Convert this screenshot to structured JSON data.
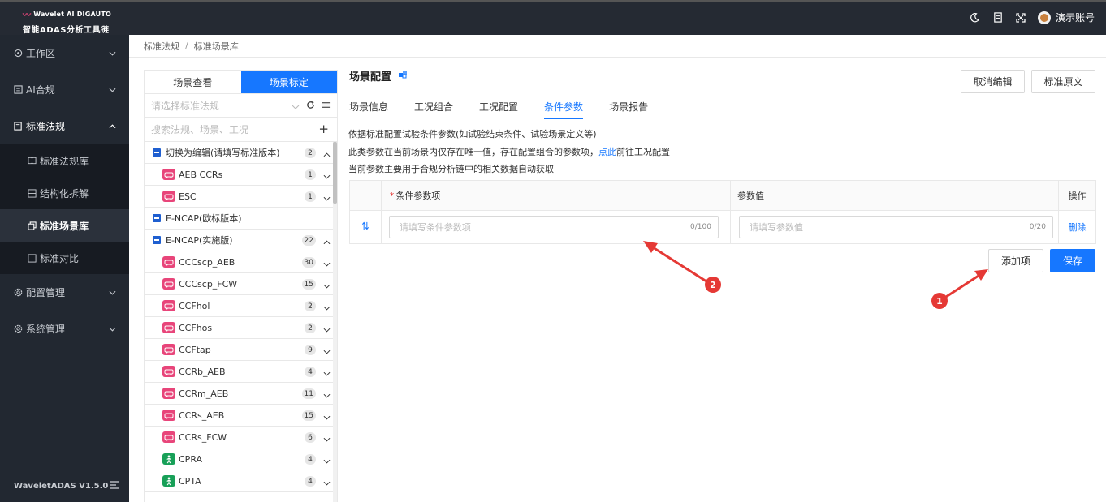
{
  "app": {
    "brand_line": "Wavelet AI  DIGAUTO",
    "subtitle": "智能ADAS分析工具链",
    "user_name": "演示账号",
    "version": "WaveletADAS  V1.5.0"
  },
  "sidebar": {
    "items": [
      {
        "label": "工作区",
        "icon": "workspace-icon"
      },
      {
        "label": "AI合规",
        "icon": "ai-compliance-icon"
      },
      {
        "label": "标准法规",
        "icon": "regulation-icon"
      },
      {
        "label": "配置管理",
        "icon": "gear-icon"
      },
      {
        "label": "系统管理",
        "icon": "gear-icon"
      }
    ],
    "sub_items": [
      {
        "label": "标准法规库"
      },
      {
        "label": "结构化拆解"
      },
      {
        "label": "标准场景库"
      },
      {
        "label": "标准对比"
      }
    ]
  },
  "breadcrumb": {
    "first": "标准法规",
    "sep": "/",
    "second": "标准场景库"
  },
  "left": {
    "tabs": [
      "场景查看",
      "场景标定"
    ],
    "select_placeholder": "请选择标准法规",
    "search_placeholder": "搜索法规、场景、工况",
    "rows": [
      {
        "label": "切换为编辑(请填写标准版本)",
        "count": "2"
      },
      {
        "label": "AEB CCRs",
        "count": "1"
      },
      {
        "label": "ESC",
        "count": "1"
      },
      {
        "label": "E-NCAP(欧标版本)",
        "count": ""
      },
      {
        "label": "E-NCAP(实施版)",
        "count": "22"
      },
      {
        "label": "CCCscp_AEB",
        "count": "30"
      },
      {
        "label": "CCCscp_FCW",
        "count": "15"
      },
      {
        "label": "CCFhol",
        "count": "2"
      },
      {
        "label": "CCFhos",
        "count": "2"
      },
      {
        "label": "CCFtap",
        "count": "9"
      },
      {
        "label": "CCRb_AEB",
        "count": "4"
      },
      {
        "label": "CCRm_AEB",
        "count": "11"
      },
      {
        "label": "CCRs_AEB",
        "count": "15"
      },
      {
        "label": "CCRs_FCW",
        "count": "6"
      },
      {
        "label": "CPRA",
        "count": "4"
      },
      {
        "label": "CPTA",
        "count": "4"
      }
    ]
  },
  "main": {
    "title": "场景配置",
    "cancel_btn": "取消编辑",
    "original_btn": "标准原文",
    "tabs": [
      "场景信息",
      "工况组合",
      "工况配置",
      "条件参数",
      "场景报告"
    ],
    "desc1": "依据标准配置试验条件参数(如试验结束条件、试验场景定义等)",
    "desc2_pre": "此类参数在当前场景内仅存在唯一值，存在配置组合的参数项，",
    "desc2_link": "点此",
    "desc2_post": "前往工况配置",
    "desc3": "当前参数主要用于合规分析链中的相关数据自动获取",
    "table": {
      "col_param": "条件参数项",
      "col_value": "参数值",
      "col_op": "操作",
      "param_placeholder": "请填写条件参数项",
      "param_count": "0/100",
      "value_placeholder": "请填写参数值",
      "value_count": "0/20",
      "delete": "删除"
    },
    "add_btn": "添加项",
    "save_btn": "保存"
  },
  "annotations": {
    "badge1": "1",
    "badge2": "2"
  },
  "colors": {
    "accent": "#1677ff",
    "sidebar": "#222831",
    "topbar": "#252a33",
    "annotation": "#e53935",
    "car_red": "#e8457a",
    "ped_green": "#18a058"
  }
}
